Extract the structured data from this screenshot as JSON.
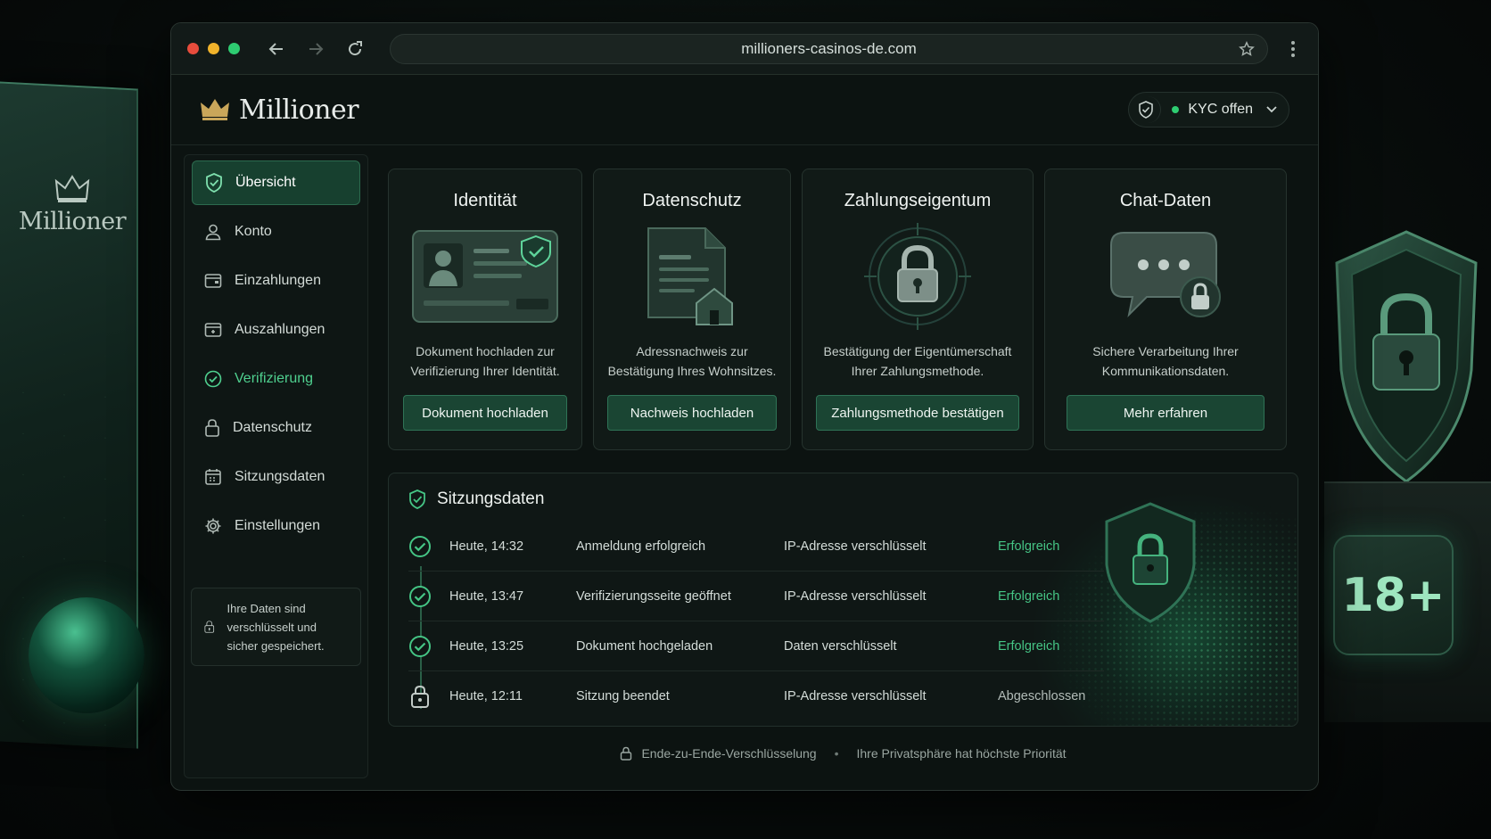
{
  "browser": {
    "url": "millioners-casinos-de.com"
  },
  "background": {
    "left_logo": "Millioner",
    "badge_18": "18+"
  },
  "header": {
    "brand": "Millioner",
    "kyc_label": "KYC offen",
    "kyc_status_color": "#2ecc71"
  },
  "sidebar": {
    "items": [
      {
        "label": "Übersicht",
        "icon": "shield-check-icon",
        "active": true
      },
      {
        "label": "Konto",
        "icon": "user-icon"
      },
      {
        "label": "Einzahlungen",
        "icon": "wallet-in-icon"
      },
      {
        "label": "Auszahlungen",
        "icon": "wallet-out-icon"
      },
      {
        "label": "Verifizierung",
        "icon": "check-circle-icon",
        "highlight": true
      },
      {
        "label": "Datenschutz",
        "icon": "lock-icon"
      },
      {
        "label": "Sitzungsdaten",
        "icon": "calendar-icon"
      },
      {
        "label": "Einstellungen",
        "icon": "gear-icon"
      }
    ],
    "secure_note": "Ihre Daten sind verschlüsselt und sicher gespeichert."
  },
  "cards": [
    {
      "title": "Identität",
      "desc": "Dokument hochladen zur Verifizierung Ihrer Identität.",
      "button": "Dokument hochladen"
    },
    {
      "title": "Datenschutz",
      "desc": "Adressnachweis zur Bestätigung Ihres Wohnsitzes.",
      "button": "Nachweis hochladen"
    },
    {
      "title": "Zahlungseigentum",
      "desc": "Bestätigung der Eigentümerschaft Ihrer Zahlungsmethode.",
      "button": "Zahlungsmethode bestätigen"
    },
    {
      "title": "Chat-Daten",
      "desc": "Sichere Verarbeitung Ihrer Kommunikationsdaten.",
      "button": "Mehr erfahren"
    }
  ],
  "session": {
    "title": "Sitzungsdaten",
    "rows": [
      {
        "time": "Heute, 14:32",
        "event": "Anmeldung erfolgreich",
        "ip": "IP-Adresse verschlüsselt",
        "status": "Erfolgreich",
        "icon": "check-circle-icon"
      },
      {
        "time": "Heute, 13:47",
        "event": "Verifizierungsseite geöffnet",
        "ip": "IP-Adresse verschlüsselt",
        "status": "Erfolgreich",
        "icon": "check-circle-icon"
      },
      {
        "time": "Heute, 13:25",
        "event": "Dokument hochgeladen",
        "ip": "Daten verschlüsselt",
        "status": "Erfolgreich",
        "icon": "check-circle-icon"
      },
      {
        "time": "Heute, 12:11",
        "event": "Sitzung beendet",
        "ip": "IP-Adresse verschlüsselt",
        "status": "Abgeschlossen",
        "icon": "lock-icon"
      }
    ]
  },
  "footer": {
    "encryption": "Ende-zu-Ende-Verschlüsselung",
    "separator": "•",
    "privacy": "Ihre Privatsphäre hat höchste Priorität"
  },
  "colors": {
    "accent": "#45c585",
    "button_bg": "#1a4533",
    "active_nav": "#17402f"
  }
}
